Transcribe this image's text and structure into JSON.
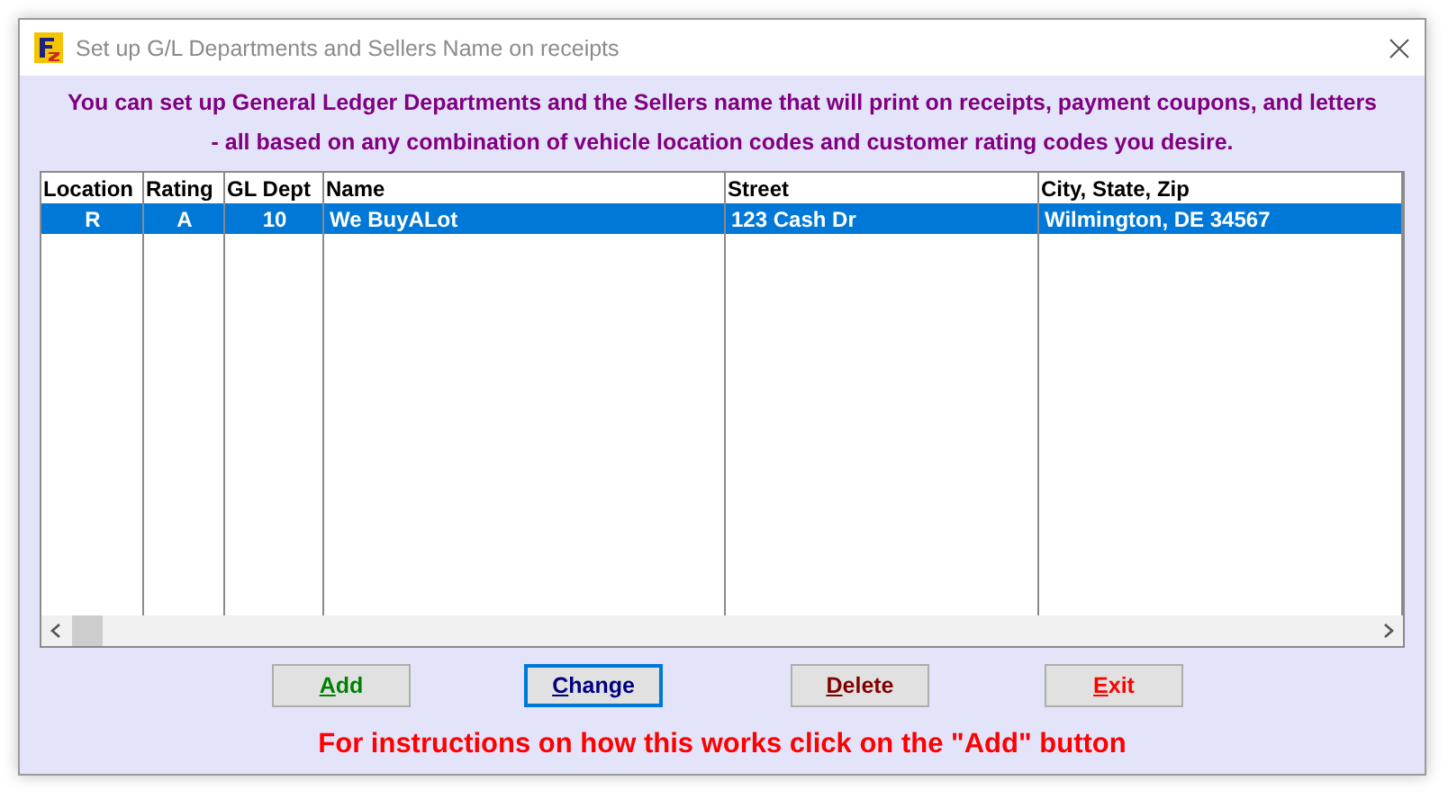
{
  "window": {
    "title": "Set up G/L Departments and  Sellers Name on receipts"
  },
  "intro": [
    "You can set up General Ledger Departments and the Sellers name that will print on receipts, payment coupons, and letters",
    "- all based on any combination of vehicle location codes and customer rating codes you desire."
  ],
  "table": {
    "columns": [
      "Location",
      "Rating",
      "GL Dept",
      "Name",
      "Street",
      "City, State, Zip"
    ],
    "rows": [
      {
        "cells": [
          "R",
          "A",
          "10",
          "We BuyALot",
          "123 Cash Dr",
          "Wilmington, DE 34567"
        ],
        "selected": true
      }
    ]
  },
  "buttons": [
    {
      "label": "Add",
      "kind": "add",
      "focused": false
    },
    {
      "label": "Change",
      "kind": "change",
      "focused": true
    },
    {
      "label": "Delete",
      "kind": "delete",
      "focused": false
    },
    {
      "label": "Exit",
      "kind": "exit",
      "focused": false
    }
  ],
  "instructions": "For instructions on how this works click on the \"Add\" button"
}
